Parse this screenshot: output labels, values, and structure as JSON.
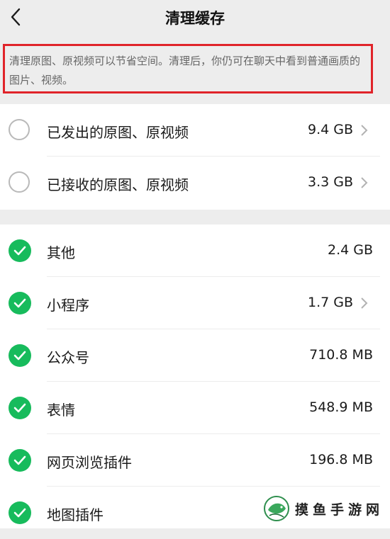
{
  "header": {
    "title": "清理缓存"
  },
  "notice": {
    "text": "清理原图、原视频可以节省空间。清理后，你仍可在聊天中看到普通画质的图片、视频。"
  },
  "original_media": [
    {
      "label": "已发出的原图、原视频",
      "size": "9.4 GB",
      "checked": false,
      "has_arrow": true
    },
    {
      "label": "已接收的原图、原视频",
      "size": "3.3 GB",
      "checked": false,
      "has_arrow": true
    }
  ],
  "cache_items": [
    {
      "label": "其他",
      "size": "2.4 GB",
      "checked": true,
      "has_arrow": false
    },
    {
      "label": "小程序",
      "size": "1.7 GB",
      "checked": true,
      "has_arrow": true
    },
    {
      "label": "公众号",
      "size": "710.8 MB",
      "checked": true,
      "has_arrow": false
    },
    {
      "label": "表情",
      "size": "548.9 MB",
      "checked": true,
      "has_arrow": false
    },
    {
      "label": "网页浏览插件",
      "size": "196.8 MB",
      "checked": true,
      "has_arrow": false
    },
    {
      "label": "地图插件",
      "size": "",
      "checked": true,
      "has_arrow": false
    }
  ],
  "watermark": {
    "text": "摸鱼手游网"
  },
  "colors": {
    "check_green": "#17bb5c",
    "highlight_red": "#e0242a",
    "background": "#ededed"
  }
}
